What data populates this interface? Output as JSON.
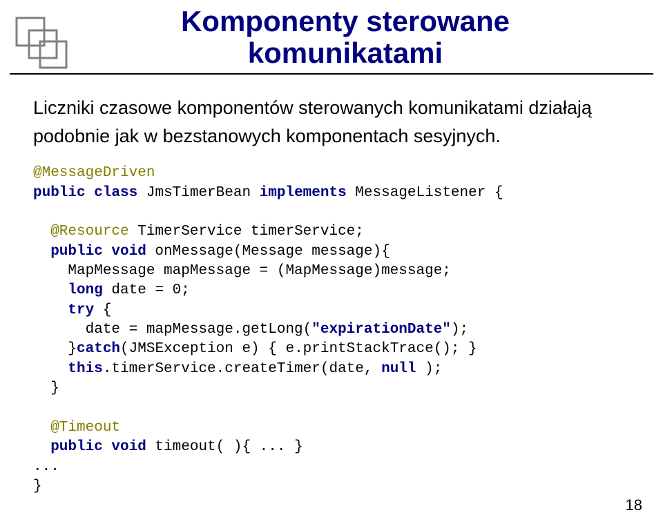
{
  "title_line1": "Komponenty sterowane",
  "title_line2": "komunikatami",
  "intro": "Liczniki czasowe komponentów sterowanych komunikatami działają podobnie jak w bezstanowych komponentach sesyjnych.",
  "code": {
    "l1a": "@MessageDriven",
    "l2a": "public class",
    "l2b": " JmsTimerBean ",
    "l2c": "implements",
    "l2d": " MessageListener {",
    "l3a": "  @Resource",
    "l3b": " TimerService timerService;",
    "l4a": "  public void",
    "l4b": " onMessage(Message message){",
    "l5a": "    MapMessage mapMessage = (MapMessage)message;",
    "l6a": "    long",
    "l6b": " date = 0;",
    "l7a": "    try",
    "l7b": " {",
    "l8a": "      date = mapMessage.getLong(",
    "l8b": "\"expirationDate\"",
    "l8c": ");",
    "l9a": "    }",
    "l9b": "catch",
    "l9c": "(JMSException e) { e.printStackTrace(); }",
    "l10a": "    this",
    "l10b": ".timerService.createTimer(date, ",
    "l10c": "null",
    "l10d": " );",
    "l11a": "  }",
    "l12a": "  @Timeout",
    "l13a": "  public void",
    "l13b": " timeout( ){ ... }",
    "l14a": "...",
    "l15a": "}"
  },
  "page_number": "18"
}
